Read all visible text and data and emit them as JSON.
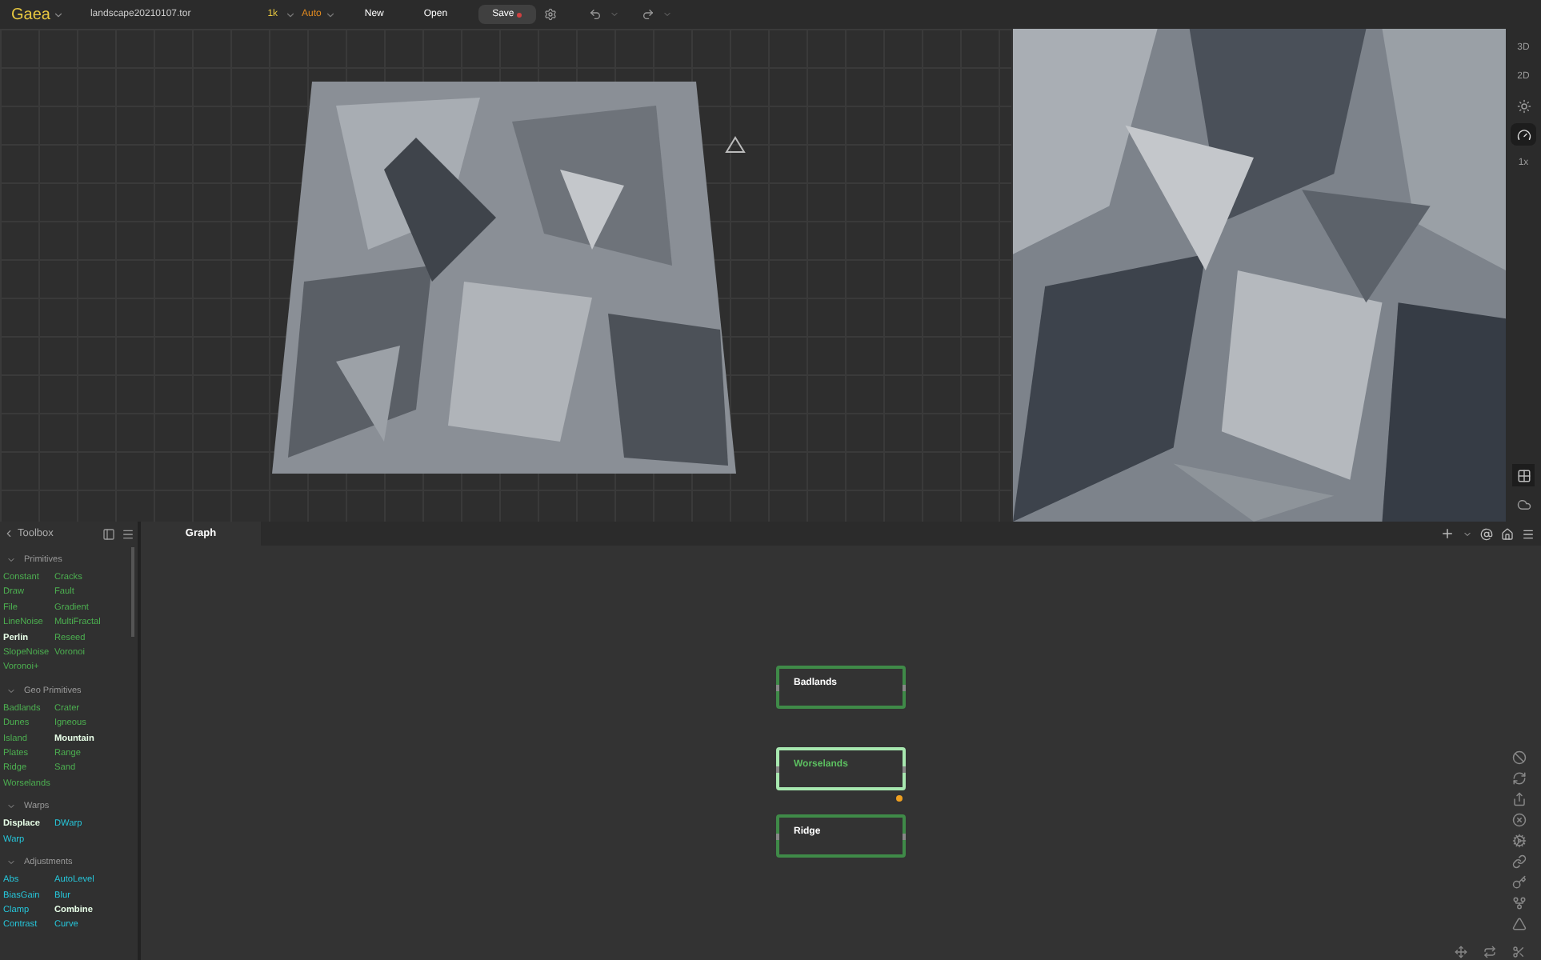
{
  "top_bar": {
    "app_name": "Gaea",
    "file_name": "landscape20210107.tor",
    "resolution": "1k",
    "mode": "Auto",
    "buttons": [
      {
        "label": "New",
        "kind": "plain"
      },
      {
        "label": "Open",
        "kind": "plain"
      },
      {
        "label": "Save",
        "kind": "save",
        "unsaved": true
      }
    ]
  },
  "view_toolbar": [
    {
      "kind": "text",
      "label": "3D",
      "active": false
    },
    {
      "kind": "text",
      "label": "2D",
      "active": false
    },
    {
      "kind": "sun",
      "active": false
    },
    {
      "kind": "gauge",
      "active": true
    },
    {
      "kind": "text",
      "label": "1x",
      "active": false
    }
  ],
  "toolbox": {
    "title": "Toolbox",
    "categories": [
      {
        "name": "Primitives",
        "color": "#4caf50",
        "items": [
          {
            "label": "Constant",
            "highlighted": false
          },
          {
            "label": "Cracks",
            "highlighted": false
          },
          {
            "label": "Draw",
            "highlighted": false
          },
          {
            "label": "Fault",
            "highlighted": false
          },
          {
            "label": "File",
            "highlighted": false
          },
          {
            "label": "Gradient",
            "highlighted": false
          },
          {
            "label": "LineNoise",
            "highlighted": false
          },
          {
            "label": "MultiFractal",
            "highlighted": false
          },
          {
            "label": "Perlin",
            "highlighted": true
          },
          {
            "label": "Reseed",
            "highlighted": false
          },
          {
            "label": "SlopeNoise",
            "highlighted": false
          },
          {
            "label": "Voronoi",
            "highlighted": false
          },
          {
            "label": "Voronoi+",
            "highlighted": false
          }
        ]
      },
      {
        "name": "Geo Primitives",
        "color": "#4caf50",
        "items": [
          {
            "label": "Badlands",
            "highlighted": false
          },
          {
            "label": "Crater",
            "highlighted": false
          },
          {
            "label": "Dunes",
            "highlighted": false
          },
          {
            "label": "Igneous",
            "highlighted": false
          },
          {
            "label": "Island",
            "highlighted": false
          },
          {
            "label": "Mountain",
            "highlighted": true
          },
          {
            "label": "Plates",
            "highlighted": false
          },
          {
            "label": "Range",
            "highlighted": false
          },
          {
            "label": "Ridge",
            "highlighted": false
          },
          {
            "label": "Sand",
            "highlighted": false
          },
          {
            "label": "Worselands",
            "highlighted": false
          }
        ]
      },
      {
        "name": "Warps",
        "color": "#26c6da",
        "items": [
          {
            "label": "Displace",
            "highlighted": true
          },
          {
            "label": "DWarp",
            "highlighted": false
          },
          {
            "label": "Warp",
            "highlighted": false
          }
        ]
      },
      {
        "name": "Adjustments",
        "color": "#26c6da",
        "items": [
          {
            "label": "Abs",
            "highlighted": false
          },
          {
            "label": "AutoLevel",
            "highlighted": false
          },
          {
            "label": "BiasGain",
            "highlighted": false
          },
          {
            "label": "Blur",
            "highlighted": false
          },
          {
            "label": "Clamp",
            "highlighted": false
          },
          {
            "label": "Combine",
            "highlighted": true
          },
          {
            "label": "Contrast",
            "highlighted": false
          },
          {
            "label": "Curve",
            "highlighted": false
          }
        ]
      }
    ]
  },
  "graph": {
    "tab": "Graph",
    "nodes": [
      {
        "label": "Badlands",
        "selected": false
      },
      {
        "label": "Worselands",
        "selected": true
      },
      {
        "label": "Ridge",
        "selected": false
      }
    ]
  }
}
